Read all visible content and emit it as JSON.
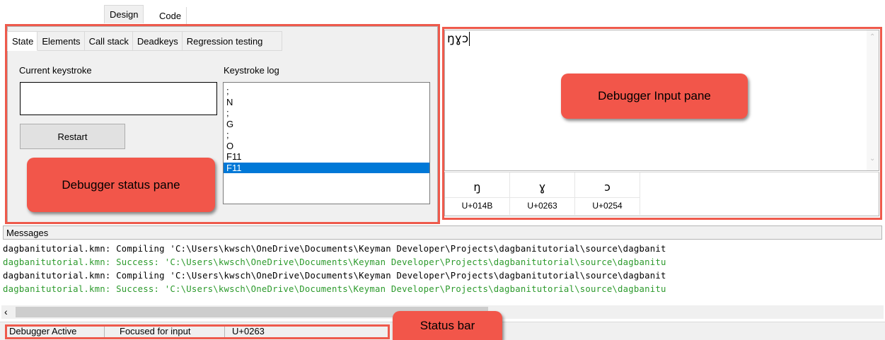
{
  "top_tabs": {
    "design": "Design",
    "code": "Code"
  },
  "status_pane": {
    "tabs": [
      "State",
      "Elements",
      "Call stack",
      "Deadkeys",
      "Regression testing"
    ],
    "current_keystroke_label": "Current keystroke",
    "current_keystroke_value": "",
    "restart_label": "Restart",
    "keystroke_log_label": "Keystroke log",
    "keystroke_log": [
      ";",
      "N",
      ";",
      "G",
      ";",
      "O",
      "F11",
      "F11"
    ],
    "selected_log_index": 7
  },
  "input_pane": {
    "text": "ŋɣɔ",
    "characters": [
      {
        "glyph": "ŋ",
        "code": "U+014B"
      },
      {
        "glyph": "ɣ",
        "code": "U+0263"
      },
      {
        "glyph": "ɔ",
        "code": "U+0254"
      }
    ]
  },
  "callouts": {
    "status_pane": "Debugger status pane",
    "input_pane": "Debugger Input pane",
    "status_bar": "Status bar"
  },
  "messages": {
    "header": "Messages",
    "lines": [
      {
        "text": "dagbanitutorial.kmn: Compiling 'C:\\Users\\kwsch\\OneDrive\\Documents\\Keyman Developer\\Projects\\dagbanitutorial\\source\\dagbanit",
        "status": "info"
      },
      {
        "text": "dagbanitutorial.kmn: Success: 'C:\\Users\\kwsch\\OneDrive\\Documents\\Keyman Developer\\Projects\\dagbanitutorial\\source\\dagbanitu",
        "status": "success"
      },
      {
        "text": "dagbanitutorial.kmn: Compiling 'C:\\Users\\kwsch\\OneDrive\\Documents\\Keyman Developer\\Projects\\dagbanitutorial\\source\\dagbanit",
        "status": "info"
      },
      {
        "text": "dagbanitutorial.kmn: Success: 'C:\\Users\\kwsch\\OneDrive\\Documents\\Keyman Developer\\Projects\\dagbanitutorial\\source\\dagbanitu",
        "status": "success"
      }
    ]
  },
  "status_bar": {
    "panels": [
      "Debugger Active",
      "Focused for input",
      "U+0263"
    ]
  },
  "colors": {
    "annotation_red": "#f2564a",
    "selection_blue": "#0078d7",
    "success_green": "#2c9a2c"
  }
}
